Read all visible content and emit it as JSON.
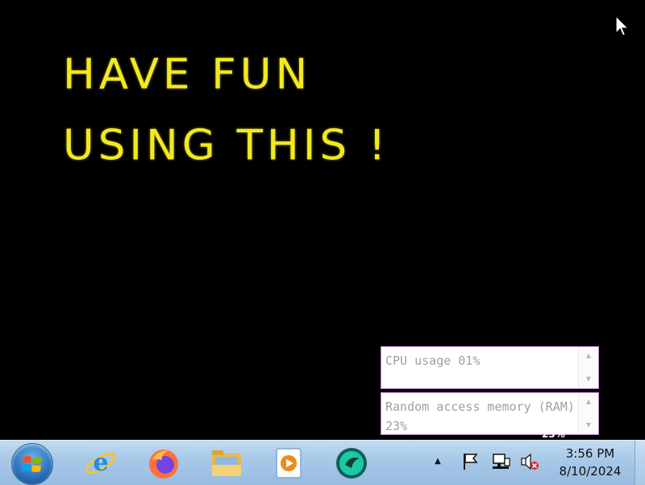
{
  "desktop": {
    "banner_line1": "HAVE FUN",
    "banner_line2": "USING THIS !",
    "banner_color": "#f2ea1e",
    "background_color": "#000000"
  },
  "widgets": {
    "cpu_text": "CPU usage 01%",
    "ram_text": "Random access memory (RAM) 23%",
    "stray_label": "23%"
  },
  "taskbar": {
    "pinned": [
      {
        "name": "Internet Explorer",
        "icon": "internet-explorer-icon"
      },
      {
        "name": "Firefox",
        "icon": "firefox-icon"
      },
      {
        "name": "File Explorer",
        "icon": "file-explorer-icon"
      },
      {
        "name": "Media Player",
        "icon": "media-player-icon"
      },
      {
        "name": "App",
        "icon": "green-app-icon"
      }
    ],
    "tray": {
      "icons": [
        "show-hidden-icons",
        "action-center-flag-icon",
        "network-icon",
        "volume-muted-icon"
      ]
    },
    "clock": {
      "time": "3:56 PM",
      "date": "8/10/2024"
    }
  }
}
